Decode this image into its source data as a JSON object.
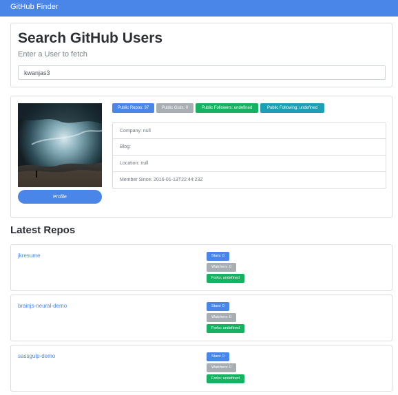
{
  "navbar": {
    "brand": "GitHub Finder"
  },
  "search": {
    "title": "Search GitHub Users",
    "subtitle": "Enter a User to fetch",
    "value": "kwanjas3"
  },
  "profile": {
    "button_label": "Profile",
    "badges": {
      "repos": "Public Repos: 37",
      "gists": "Public Gists: 0",
      "followers": "Public Followers: undefined",
      "following": "Public Following: undefined"
    },
    "info": {
      "company": "Company: null",
      "blog": "Blog:",
      "location": "Location: null",
      "member_since": "Member Since: 2016-01-13T22:44:23Z"
    }
  },
  "repos": {
    "title": "Latest Repos",
    "items": [
      {
        "name": "jkresume",
        "stars": "Stars: 0",
        "watchers": "Watchers: 0",
        "forks": "Forks: undefined"
      },
      {
        "name": "brainjs-neural-demo",
        "stars": "Stars: 0",
        "watchers": "Watchers: 0",
        "forks": "Forks: undefined"
      },
      {
        "name": "sassgulp-demo",
        "stars": "Stars: 0",
        "watchers": "Watchers: 0",
        "forks": "Forks: undefined"
      }
    ]
  },
  "colors": {
    "primary": "#4a86e8",
    "secondary": "#a9aeb3",
    "success": "#16b262",
    "info": "#1ba0b5"
  }
}
